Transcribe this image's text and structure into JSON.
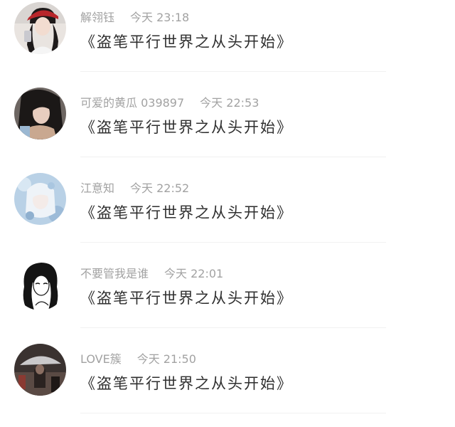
{
  "comments": [
    {
      "username": "解翎钰",
      "time": "今天 23:18",
      "text": "《盗笔平行世界之从头开始》",
      "avatar": "selfie-red-cap"
    },
    {
      "username": "可爱的黄瓜 039897",
      "time": "今天 22:53",
      "text": "《盗笔平行世界之从头开始》",
      "avatar": "selfie-dark-hair"
    },
    {
      "username": "江意知",
      "time": "今天 22:52",
      "text": "《盗笔平行世界之从头开始》",
      "avatar": "anime-white-hair"
    },
    {
      "username": "不要管我是谁",
      "time": "今天 22:01",
      "text": "《盗笔平行世界之从头开始》",
      "avatar": "manga-lineart"
    },
    {
      "username": "LOVE簇",
      "time": "今天 21:50",
      "text": "《盗笔平行世界之从头开始》",
      "avatar": "umbrella-photo"
    }
  ]
}
